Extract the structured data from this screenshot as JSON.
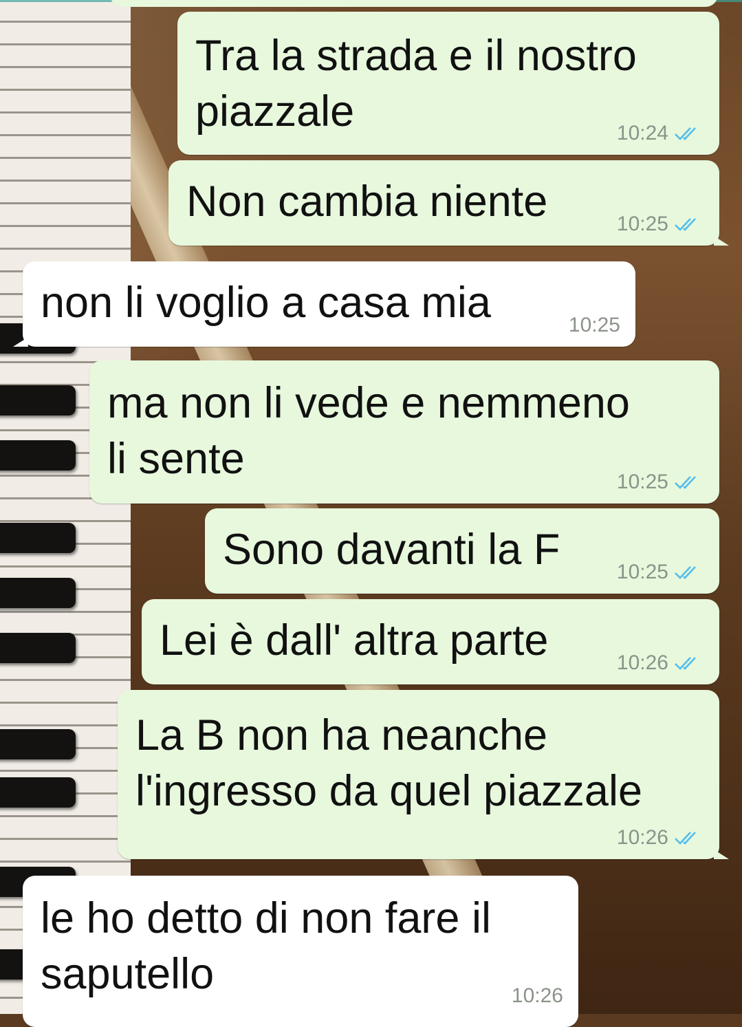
{
  "wallpaper": {
    "description_icon": "piano-wallpaper"
  },
  "colors": {
    "outgoing_bubble": "#e7f8dd",
    "incoming_bubble": "#ffffff",
    "read_ticks": "#53bdeb",
    "time_text": "#8b9389"
  },
  "messages": [
    {
      "direction": "out",
      "text": "Tra la strada e il nostro\npiazzale",
      "time": "10:24",
      "status": "read"
    },
    {
      "direction": "out",
      "text": "Non cambia niente",
      "time": "10:25",
      "status": "read"
    },
    {
      "direction": "in",
      "text": "non li voglio a casa mia",
      "time": "10:25"
    },
    {
      "direction": "out",
      "text": "ma non li vede e nemmeno\nli sente",
      "time": "10:25",
      "status": "read"
    },
    {
      "direction": "out",
      "text": "Sono davanti la F",
      "time": "10:25",
      "status": "read"
    },
    {
      "direction": "out",
      "text": "Lei è dall' altra parte",
      "time": "10:26",
      "status": "read"
    },
    {
      "direction": "out",
      "text": "La B non ha neanche\nl'ingresso da quel piazzale",
      "time": "10:26",
      "status": "read"
    },
    {
      "direction": "in",
      "text": "le ho detto di non fare il\nsaputello",
      "time": "10:26"
    }
  ]
}
